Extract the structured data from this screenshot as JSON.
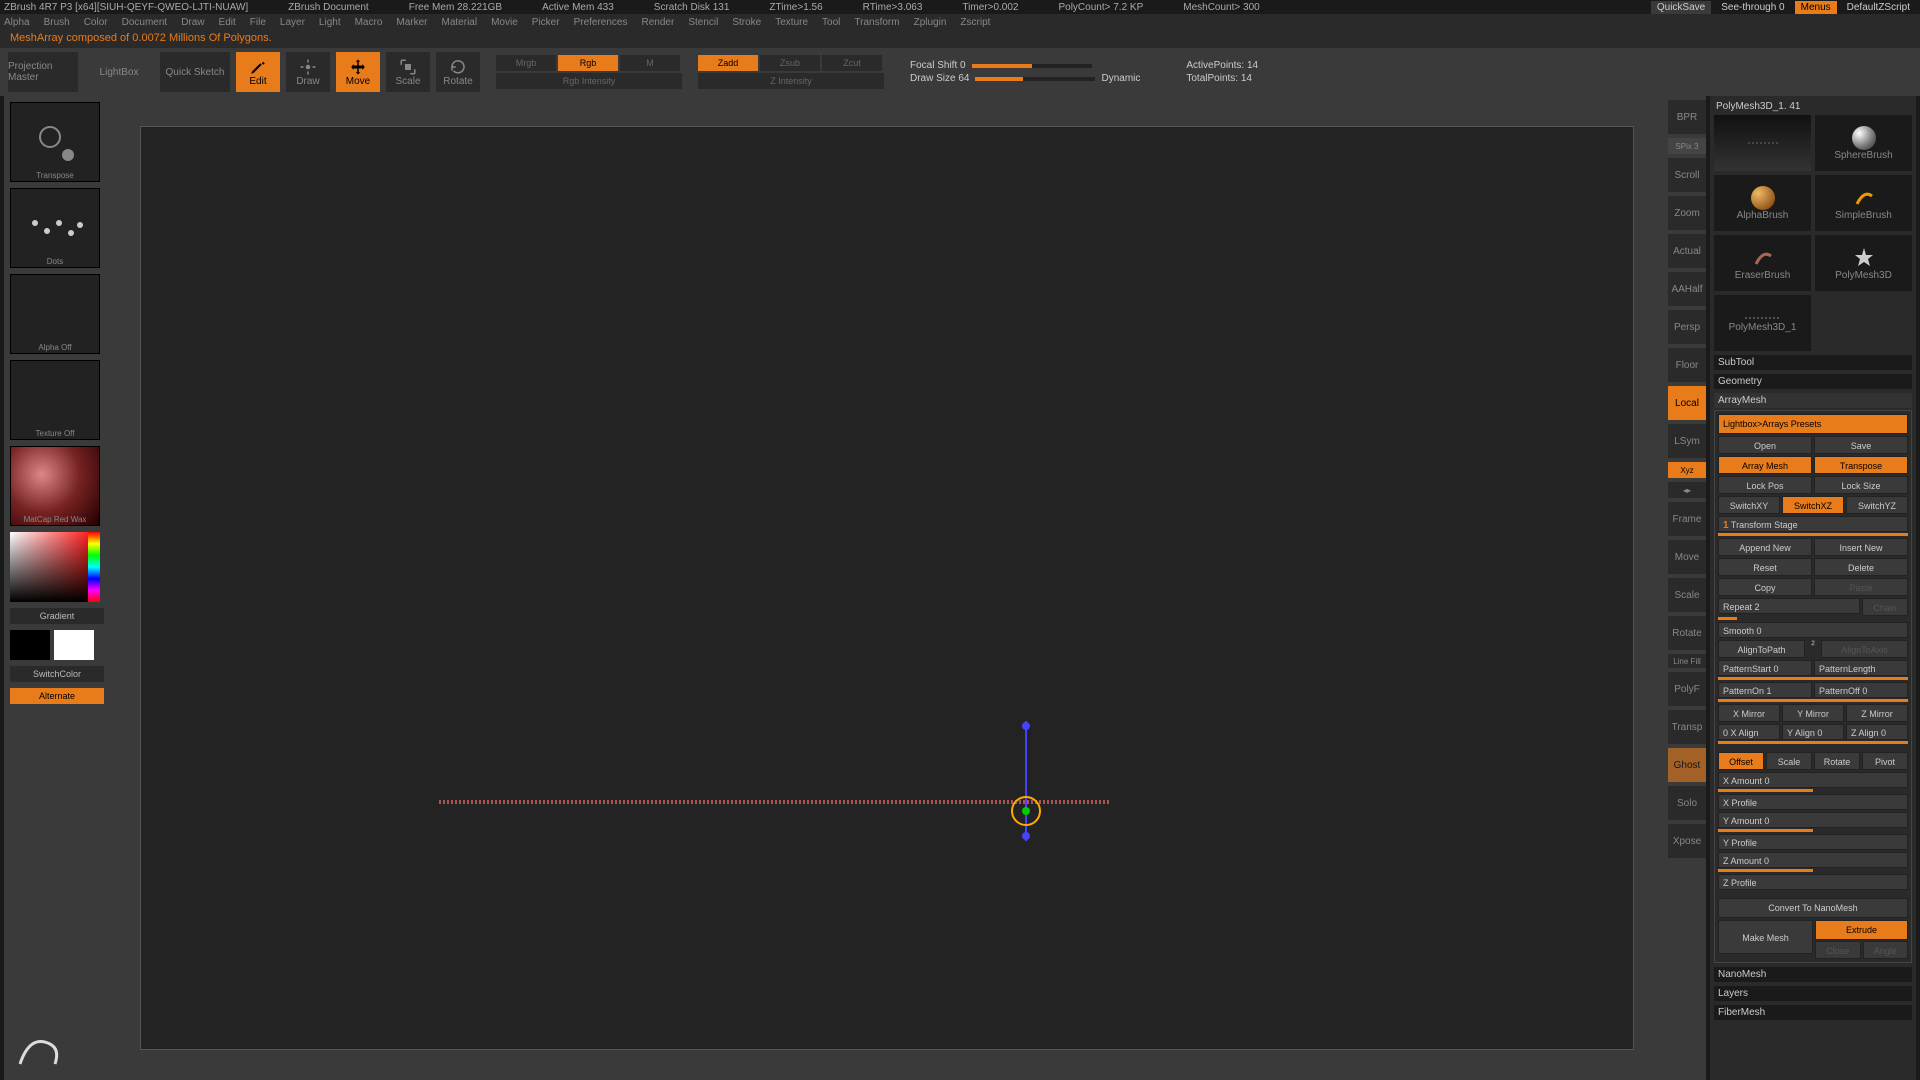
{
  "titlebar": {
    "app": "ZBrush 4R7 P3 [x64][SIUH-QEYF-QWEO-LJTI-NUAW]",
    "doc": "ZBrush Document",
    "stats": [
      "Free Mem 28.221GB",
      "Active Mem 433",
      "Scratch Disk 131",
      "ZTime>1.56",
      "RTime>3.063",
      "Timer>0.002",
      "PolyCount> 7.2 KP",
      "MeshCount> 300"
    ],
    "quicksave": "QuickSave",
    "seethrough": "See-through  0",
    "menus": "Menus",
    "script": "DefaultZScript"
  },
  "menubar": [
    "Alpha",
    "Brush",
    "Color",
    "Document",
    "Draw",
    "Edit",
    "File",
    "Layer",
    "Light",
    "Macro",
    "Marker",
    "Material",
    "Movie",
    "Picker",
    "Preferences",
    "Render",
    "Stencil",
    "Stroke",
    "Texture",
    "Tool",
    "Transform",
    "Zplugin",
    "Zscript"
  ],
  "status": "MeshArray composed of 0.0072 Millions Of Polygons.",
  "toolbar": {
    "projection": "Projection\nMaster",
    "lightbox": "LightBox",
    "quicksketch": "Quick\nSketch",
    "edit": "Edit",
    "draw": "Draw",
    "move": "Move",
    "scale": "Scale",
    "rotate": "Rotate",
    "mrgb": "Mrgb",
    "rgb": "Rgb",
    "m": "M",
    "zadd": "Zadd",
    "zsub": "Zsub",
    "zcut": "Zcut",
    "rgbintensity": "Rgb Intensity",
    "zintensity": "Z Intensity",
    "focalshift": "Focal Shift 0",
    "drawsize": "Draw Size 64",
    "dynamic": "Dynamic",
    "activepoints": "ActivePoints: 14",
    "totalpoints": "TotalPoints: 14"
  },
  "left": {
    "transpose": "Transpose",
    "dots": "Dots",
    "alpha": "Alpha Off",
    "texture": "Texture Off",
    "matcap": "MatCap Red Wax",
    "gradient": "Gradient",
    "switchcolor": "SwitchColor",
    "alternate": "Alternate"
  },
  "right_tray": {
    "bpr": "BPR",
    "spix": "SPix 3",
    "scroll": "Scroll",
    "zoom": "Zoom",
    "actual": "Actual",
    "aahalf": "AAHalf",
    "persp": "Persp",
    "floor": "Floor",
    "local": "Local",
    "lsym": "LSym",
    "xyz": "Xyz",
    "frame": "Frame",
    "move": "Move",
    "scale": "Scale",
    "rotate": "Rotate",
    "linefill": "Line Fill",
    "polyf": "PolyF",
    "transp": "Transp",
    "ghost": "Ghost",
    "solo": "Solo",
    "xpose": "Xpose"
  },
  "tools": {
    "spherebrush": "SphereBrush",
    "alphabrush": "AlphaBrush",
    "simplebrush": "SimpleBrush",
    "eraserbrush": "EraserBrush",
    "polymesh3d": "PolyMesh3D",
    "polymesh3d1": "PolyMesh3D_1",
    "current": "PolyMesh3D_1. 41"
  },
  "panel": {
    "subtool": "SubTool",
    "geometry": "Geometry",
    "arraymesh": "ArrayMesh",
    "lightbox_presets": "Lightbox>Arrays Presets",
    "open": "Open",
    "save": "Save",
    "array_mesh": "Array Mesh",
    "transpose": "Transpose",
    "lock_pos": "Lock Pos",
    "lock_size": "Lock Size",
    "switchxy": "SwitchXY",
    "switchxz": "SwitchXZ",
    "switchyz": "SwitchYZ",
    "transform_stage": "1 Transform Stage",
    "append_new": "Append New",
    "insert_new": "Insert New",
    "reset": "Reset",
    "delete": "Delete",
    "copy": "Copy",
    "paste": "Paste",
    "repeat": "Repeat 2",
    "chain": "Chain",
    "smooth": "Smooth 0",
    "aligntopath": "AlignToPath",
    "aligntoaxis": "AlignToAxis",
    "patternstart": "PatternStart 0",
    "patternlength": "PatternLength",
    "patternon": "PatternOn 1",
    "patternoff": "PatternOff 0",
    "xmirror": "X Mirror",
    "ymirror": "Y Mirror",
    "zmirror": "Z Mirror",
    "xalign": "0 X Align",
    "yalign": "Y Align 0",
    "zalign": "Z Align 0",
    "offset": "Offset",
    "scale": "Scale",
    "rotate": "Rotate",
    "pivot": "Pivot",
    "xamount": "X Amount 0",
    "xprofile": "X Profile",
    "yamount": "Y Amount 0",
    "yprofile": "Y Profile",
    "zamount": "Z Amount 0",
    "zprofile": "Z Profile",
    "convert": "Convert To NanoMesh",
    "makemesh": "Make Mesh",
    "extrude": "Extrude",
    "close": "Close",
    "angle": "Angle",
    "nanomesh": "NanoMesh",
    "layers": "Layers",
    "fibermesh": "FiberMesh"
  }
}
